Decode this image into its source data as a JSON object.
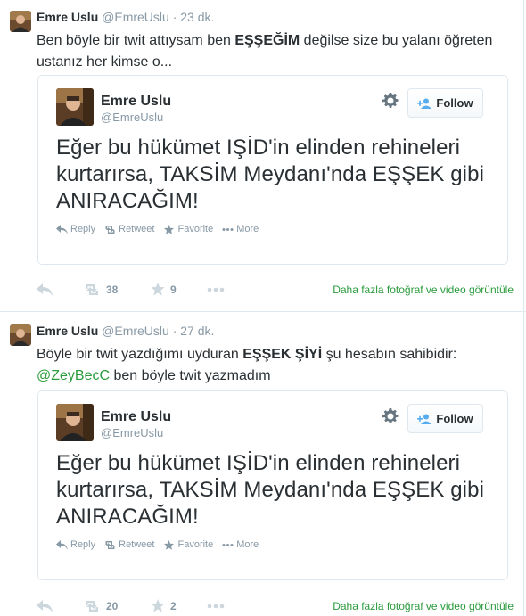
{
  "colors": {
    "link": "#55acee",
    "green": "#2a9b3c",
    "muted": "#8899a6",
    "text": "#292f33",
    "border": "#e1e8ed"
  },
  "tweets": [
    {
      "fullname": "Emre Uslu",
      "screenname": "@EmreUslu",
      "dot": "·",
      "time": "23 dk.",
      "text_a": "Ben böyle bir twit attıysam ben ",
      "text_bold": "EŞŞEĞİM",
      "text_b": " değilse size bu yalanı öğreten ustanız her kimse o...",
      "embed": {
        "name": "Emre Uslu",
        "handle": "@EmreUslu",
        "follow_label": "Follow",
        "text": "Eğer bu hükümet IŞİD'in elinden rehineleri kurtarırsa, TAKSİM Meydanı'nda EŞŞEK gibi ANIRACAĞIM!",
        "actions": [
          "Reply",
          "Retweet",
          "Favorite",
          "More"
        ]
      },
      "retweet_count": "38",
      "favorite_count": "9",
      "media_link": "Daha fazla fotoğraf ve video görüntüle"
    },
    {
      "fullname": "Emre Uslu",
      "screenname": "@EmreUslu",
      "dot": "·",
      "time": "27 dk.",
      "text_a": "Böyle bir twit yazdığımı uyduran ",
      "text_bold": "EŞŞEK ŞİYİ",
      "text_b": " şu hesabın sahibidir:",
      "mention": "@ZeyBecC",
      "text_c": " ben böyle twit yazmadım",
      "embed": {
        "name": "Emre Uslu",
        "handle": "@EmreUslu",
        "follow_label": "Follow",
        "text": "Eğer bu hükümet IŞİD'in elinden rehineleri kurtarırsa, TAKSİM Meydanı'nda EŞŞEK gibi ANIRACAĞIM!",
        "actions": [
          "Reply",
          "Retweet",
          "Favorite",
          "More"
        ]
      },
      "retweet_count": "20",
      "favorite_count": "2",
      "media_link": "Daha fazla fotoğraf ve video görüntüle"
    }
  ]
}
